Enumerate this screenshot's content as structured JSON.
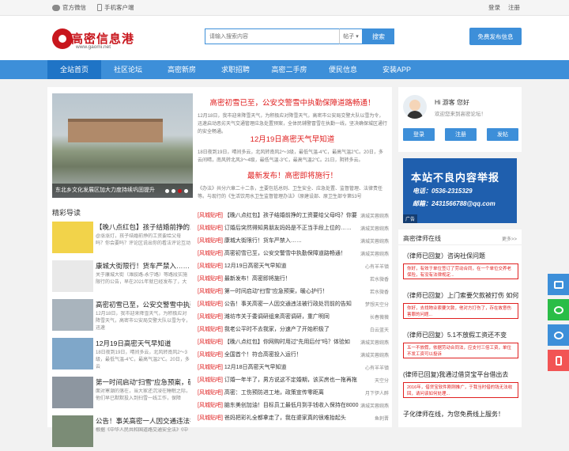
{
  "topbar": {
    "wechat": "官方微信",
    "mobile": "手机客户端",
    "login": "登录",
    "register": "注册"
  },
  "logo": {
    "name": "高密信息港",
    "url": "www.gaomi.net"
  },
  "search": {
    "placeholder": "请输入搜索内容",
    "type": "帖子",
    "button": "搜索"
  },
  "publish": "免费发布信息",
  "nav": [
    "全站首页",
    "社区论坛",
    "高密新房",
    "求职招聘",
    "高密二手房",
    "便民信息",
    "安装APP"
  ],
  "slide": {
    "caption": "东北乡文化发展区加大力度持续巩固提升"
  },
  "headlines": [
    {
      "title": "高密初雪已至，公安交警雪中执勤保障道路畅通！",
      "text": "12月18日，我市迎来降雪天气，为积极应对降雪天气，高密市公安局交警大队以雪为令，迅速启动恶劣天气交通管理应急处置预案，全体民辅警冒雪在执勤一线，坚决确保城区通行的安全畅通。"
    },
    {
      "title": "12月19日高密天气早知道",
      "text": "18日夜到19日，晴间多云，北风转南风2～3级，最低气温-4℃，最高气温2℃。20日，多云间晴，南风转北风3～4级，最低气温-3℃，最高气温2℃。21日，阴转多云。"
    },
    {
      "title": "最新发布！高密即将施行！",
      "text": "《办法》共分六章二十二条，主要包括总则、卫生安全、应急处置、监督管理、法律责任等。与现行的《生活饮用水卫生监督管理办法》（原建设部、原卫生部令第53号"
    }
  ],
  "picks_title": "精彩导读",
  "picks": [
    {
      "title": "【晚八点红包】孩子结婚前挣的工",
      "desc": "@涨涨灯，孩子结婚前挣的工资要给父母吗？你会要吗？评论区说出你的看法评论互动"
    },
    {
      "title": "康城大街限行！货车严禁入……",
      "desc": "关于康城大街（潍胶路-永宁路）等路段实施限行的公告，早在2021年就已经发布了，大"
    },
    {
      "title": "高密初雪已至，公安交警雪中执勤",
      "desc": "12月18日，我市迎来降雪天气，为积极应对降雪天气，高密市公安局交警大队以雪为令，迅速"
    },
    {
      "title": "12月19日高密天气早知道",
      "desc": "18日夜到19日，晴间多云，北风转南风2～3级，最低气温-4℃，最高气温2℃。20日，多云"
    },
    {
      "title": "第一时间启动\"扫雪\"应急预案，确",
      "desc": "面对寒潮的落在，当大家还沉浸在睡眠之际，他们早已默默投入到扫雪一线工作，保障"
    },
    {
      "title": "公告！事关高密一人因交通违法被",
      "desc": "根据《中华人民共和国道路交通安全法》《中"
    }
  ],
  "list": [
    {
      "tag": "[风城贴吧]",
      "title": "【晚八点红包】孩子结婚前挣的工资要给父母吗？你要",
      "author": "满城芙蓉婉燕"
    },
    {
      "tag": "[风城贴吧]",
      "title": "订婚后突然得知男朋友妈妈是不正当手段上位的……",
      "author": "满城芙蓉婉燕"
    },
    {
      "tag": "[风城贴吧]",
      "title": "康城大街限行！货车严禁入……",
      "author": "满城芙蓉婉燕"
    },
    {
      "tag": "[风城贴吧]",
      "title": "高密初雪已至，公安交警雪中执勤保障道路畅通！",
      "author": "满城芙蓉婉燕"
    },
    {
      "tag": "[风城贴吧]",
      "title": "12月19日高密天气早知道",
      "author": "心有羊羊镇"
    },
    {
      "tag": "[风城贴吧]",
      "title": "最新发布！高密即将施行！",
      "author": "若水微香"
    },
    {
      "tag": "[风城贴吧]",
      "title": "第一时间启动\"扫雪\"应急预案，暖心护行！",
      "author": "若水微香"
    },
    {
      "tag": "[风城贴吧]",
      "title": "公告！事关高密一人因交通违法被行政处罚前的告知",
      "author": "梦想天空分"
    },
    {
      "tag": "[风城贴吧]",
      "title": "潍坊市关于委调研组来高密调研，重广明同",
      "author": "长春薇薇"
    },
    {
      "tag": "[风城贴吧]",
      "title": "我老公平时不去我家，分速产了开始积极了",
      "author": "白云蓝天"
    },
    {
      "tag": "[风城贴吧]",
      "title": "【晚八点红包】你网购时用过\"先用后付\"吗？体验如",
      "author": "满城芙蓉婉燕"
    },
    {
      "tag": "[风城贴吧]",
      "title": "全国首个！符合高密投入运行！",
      "author": "满城芙蓉婉燕"
    },
    {
      "tag": "[风城贴吧]",
      "title": "12月18日高密天气早知道",
      "author": "心有羊羊镇"
    },
    {
      "tag": "[风城贴吧]",
      "title": "订婚一年半了，男方说这不定婚期，该买房也一拖再拖",
      "author": "天空分"
    },
    {
      "tag": "[风城贴吧]",
      "title": "高密：工伤预防进工地，政策宣传零距离",
      "author": "月下伊人醉"
    },
    {
      "tag": "[风城贴吧]",
      "title": "脑东美创加油！目标员工最低月到手钱收入保持在8000",
      "author": "满城芙蓉婉燕"
    },
    {
      "tag": "[风城贴吧]",
      "title": "爸妈把彩礼全都拿走了，我在婆家真的很难抬起头",
      "author": "鱼刺晋"
    }
  ],
  "user": {
    "greeting": "Hi 游客 您好",
    "welcome": "欢迎您来到高密论坛！",
    "login": "登录",
    "register": "注册",
    "post": "发帖"
  },
  "ad": {
    "title": "本站不良内容举报",
    "phone": "电话：0536-2315329",
    "email": "邮箱：2431566788@qq.com",
    "label": "广告"
  },
  "lawyer": {
    "title": "高密律师在线",
    "more": "更多>>",
    "items": [
      {
        "q": "（律师已回复）咨询社保问题",
        "a": "你好，有效于单位签订了劳动合同，在一个单位交养老保险，有没有法律规定..."
      },
      {
        "q": "（律师已回复）上门索要欠款被打伤 如何",
        "a": "你好，去找物业索要欠款，他对方打伤了，存在故意伤害罪的问题..."
      },
      {
        "q": "（律师已回复）5.1不放假工资还不变",
        "a": "五一不放假，依据劳动合同法，应支付三倍工资，单位不发工资可以投诉"
      },
      {
        "q": "(律师已回复)我通过借贷宝平台借出去",
        "a": "2016年，借贷宝软件刚刚推广，于我当时借的钱无法收回，请问该如何处理..."
      },
      {
        "q": "子化律师在线，为您免费线上服务！",
        "a": ""
      }
    ]
  }
}
